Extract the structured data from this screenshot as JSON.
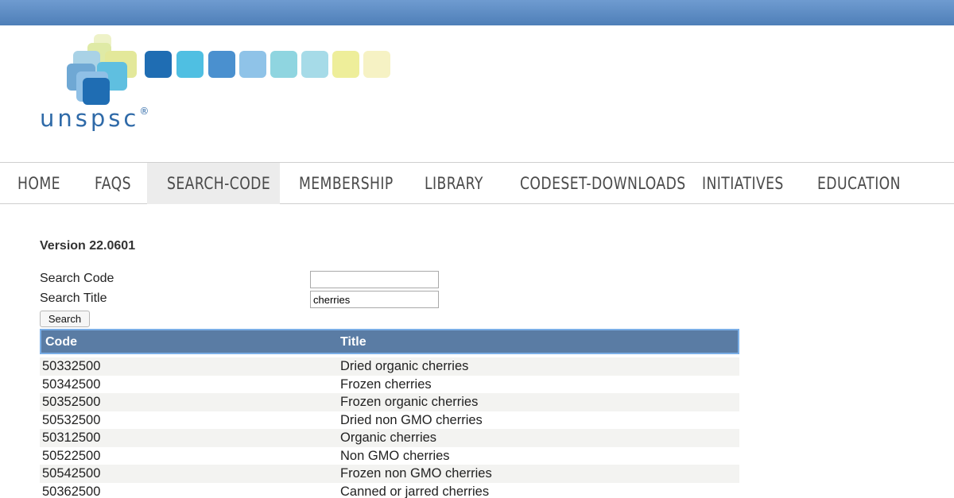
{
  "logo": {
    "text": "unspsc",
    "mark": "®"
  },
  "nav": [
    {
      "label": "HOME"
    },
    {
      "label": "FAQS"
    },
    {
      "label": "SEARCH-CODE"
    },
    {
      "label": "MEMBERSHIP"
    },
    {
      "label": "LIBRARY"
    },
    {
      "label": "CODESET-DOWNLOADS"
    },
    {
      "label": "INITIATIVES"
    },
    {
      "label": "EDUCATION"
    }
  ],
  "active_nav": "SEARCH-CODE",
  "version": "Version 22.0601",
  "search": {
    "code_label": "Search Code",
    "code_value": "",
    "title_label": "Search Title",
    "title_value": "cherries",
    "button_label": "Search"
  },
  "table": {
    "headers": [
      "Code",
      "Title"
    ],
    "rows": [
      [
        "50332500",
        "Dried organic cherries"
      ],
      [
        "50342500",
        "Frozen cherries"
      ],
      [
        "50352500",
        "Frozen organic cherries"
      ],
      [
        "50532500",
        "Dried non GMO cherries"
      ],
      [
        "50312500",
        "Organic cherries"
      ],
      [
        "50522500",
        "Non GMO cherries"
      ],
      [
        "50542500",
        "Frozen non GMO cherries"
      ],
      [
        "50362500",
        "Canned or jarred cherries"
      ]
    ]
  },
  "colors": {
    "top_bar": "#5b88c0",
    "table_header": "#5a7ca4",
    "row_alt": "#f3f3f1",
    "logo_text": "#2f6aa8"
  }
}
